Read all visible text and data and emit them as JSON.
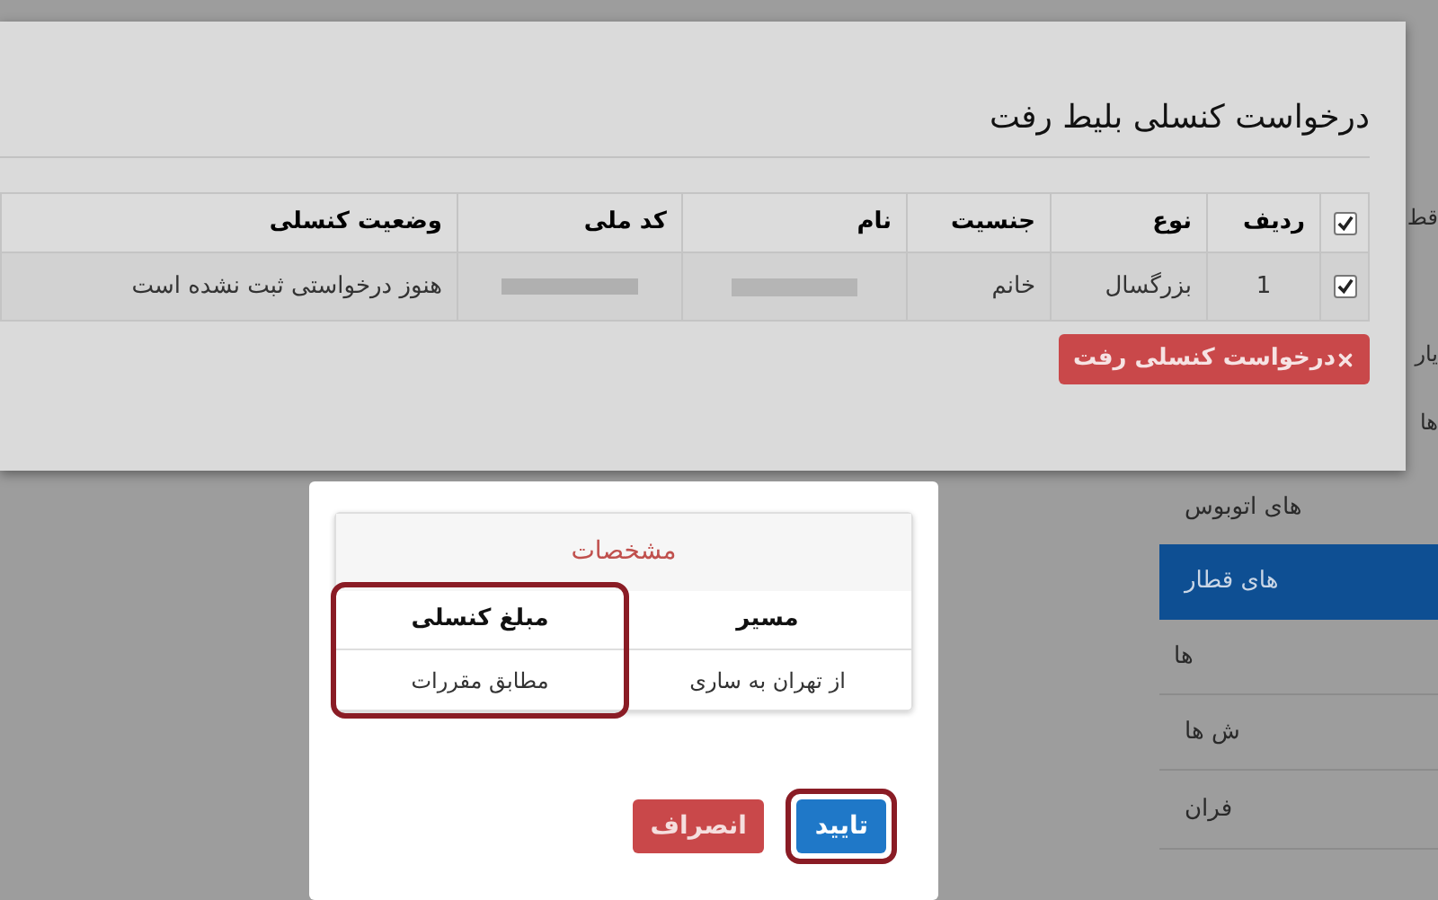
{
  "cancel_dialog": {
    "title": "درخواست کنسلی بلیط رفت",
    "table": {
      "header_checked": true,
      "columns": [
        "ردیف",
        "نوع",
        "جنسیت",
        "نام",
        "کد ملی",
        "وضعیت کنسلی"
      ],
      "rows": [
        {
          "checked": true,
          "row_number": "1",
          "type": "بزرگسال",
          "gender": "خانم",
          "status": "هنوز درخواستی ثبت نشده است"
        }
      ]
    },
    "cancel_button": "درخواست کنسلی رفت"
  },
  "sidebar": {
    "items": [
      {
        "label": "قط",
        "selected": false
      },
      {
        "label": "یار",
        "selected": false
      },
      {
        "label": "ها",
        "selected": false
      },
      {
        "label": "های اتوبوس",
        "selected": false
      },
      {
        "label": "های قطار",
        "selected": true
      },
      {
        "label": "ها",
        "selected": false
      },
      {
        "label": "ش ها",
        "selected": false
      },
      {
        "label": "فران",
        "selected": false
      }
    ]
  },
  "confirm_modal": {
    "panel_title": "مشخصات",
    "columns": [
      {
        "heading": "مسیر",
        "value": "از تهران به ساری",
        "highlighted": false
      },
      {
        "heading": "مبلغ کنسلی",
        "value": "مطابق مقررات",
        "highlighted": true
      }
    ],
    "buttons": [
      {
        "kind": "primary",
        "label": "تایید",
        "highlighted": true
      },
      {
        "kind": "danger",
        "label": "انصراف",
        "highlighted": false
      }
    ]
  }
}
